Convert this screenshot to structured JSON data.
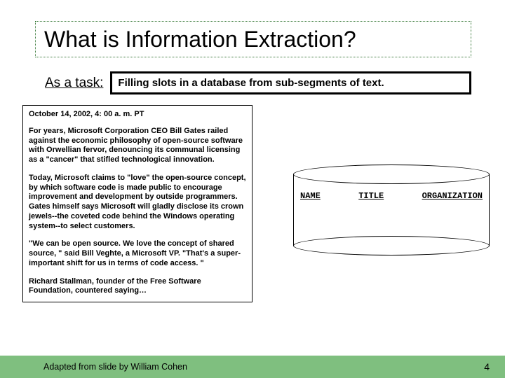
{
  "title": "What is Information Extraction?",
  "subtitle": {
    "label": "As a task:",
    "definition": "Filling slots in a database from sub-segments of text."
  },
  "article": {
    "date": "October 14, 2002, 4: 00 a. m. PT",
    "p1": "For years, Microsoft Corporation CEO Bill Gates railed against the economic philosophy of open-source software with Orwellian fervor, denouncing its communal licensing as a \"cancer\" that stifled technological innovation.",
    "p2": "Today, Microsoft claims to \"love\" the open-source concept, by which software code is made public to encourage improvement and development by outside programmers. Gates himself says Microsoft will gladly disclose its crown jewels--the coveted code behind the Windows operating system--to select customers.",
    "p3": "\"We can be open source. We love the concept of shared source, \" said Bill Veghte, a Microsoft VP. \"That's a super-important shift for us in terms of code access. \"",
    "p4": "Richard Stallman, founder of the Free Software Foundation, countered saying…"
  },
  "db": {
    "col1": "NAME",
    "col2": "TITLE",
    "col3": "ORGANIZATION"
  },
  "footer": {
    "credit": "Adapted from slide by William Cohen",
    "page": "4"
  }
}
